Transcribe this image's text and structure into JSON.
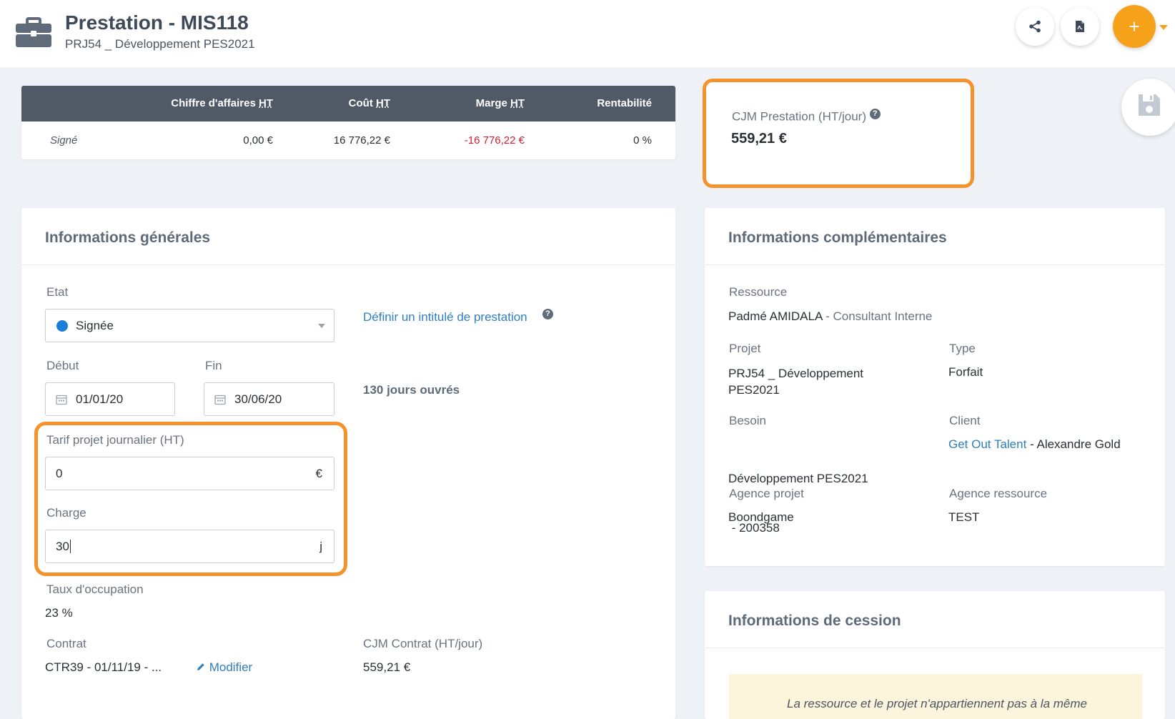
{
  "header": {
    "title": "Prestation - MIS118",
    "subtitle": "PRJ54 _ Développement PES2021",
    "add_label": "+"
  },
  "financial": {
    "columns": [
      "Chiffre d'affaires",
      "Coût",
      "Marge",
      "Rentabilité"
    ],
    "column_suffix": "HT",
    "row": {
      "label": "Signé",
      "revenue": "0,00 €",
      "cost": "16 776,22 €",
      "margin": "-16 776,22 €",
      "profitability": "0 %"
    }
  },
  "cjm": {
    "label": "CJM Prestation (HT/jour)",
    "value": "559,21 €",
    "help": "?"
  },
  "general": {
    "title": "Informations générales",
    "etat_label": "Etat",
    "etat_value": "Signée",
    "define_title_link": "Définir un intitulé de prestation",
    "help": "?",
    "debut_label": "Début",
    "debut_value": "01/01/20",
    "fin_label": "Fin",
    "fin_value": "30/06/20",
    "working_days": "130 jours ouvrés",
    "tarif_label": "Tarif projet journalier (HT)",
    "tarif_value": "0",
    "tarif_suffix": "€",
    "charge_label": "Charge",
    "charge_value": "30",
    "charge_suffix": "j",
    "occupation_label": "Taux d'occupation",
    "occupation_value": "23 %",
    "contrat_label": "Contrat",
    "contrat_value": "CTR39 - 01/11/19 - ...",
    "modifier_link": "Modifier",
    "cjm_contrat_label": "CJM Contrat (HT/jour)",
    "cjm_contrat_value": "559,21 €"
  },
  "complementary": {
    "title": "Informations complémentaires",
    "ressource_label": "Ressource",
    "ressource_name": "Padmé AMIDALA",
    "ressource_role": "- Consultant Interne",
    "projet_label": "Projet",
    "projet_value_line1": "PRJ54 _ Développement",
    "projet_value_line2": "PES2021",
    "type_label": "Type",
    "type_value": "Forfait",
    "besoin_label": "Besoin",
    "besoin_value_line1": "Développement PES2021",
    "besoin_value_line2": " - 200358",
    "client_label": "Client",
    "client_company": "Get Out Talent",
    "client_separator": " - ",
    "client_contact": "Alexandre Gold",
    "agence_projet_label": "Agence projet",
    "agence_projet_value": "Boondgame",
    "agence_ressource_label": "Agence ressource",
    "agence_ressource_value": "TEST"
  },
  "cession": {
    "title": "Informations de cession",
    "notice": "La ressource et le projet n'appartiennent pas à la même"
  },
  "colors": {
    "accent_orange": "#f5922b",
    "add_button": "#f7a21b",
    "link_blue": "#2f7fc0",
    "negative_red": "#d0202e",
    "table_header": "#505a66"
  }
}
